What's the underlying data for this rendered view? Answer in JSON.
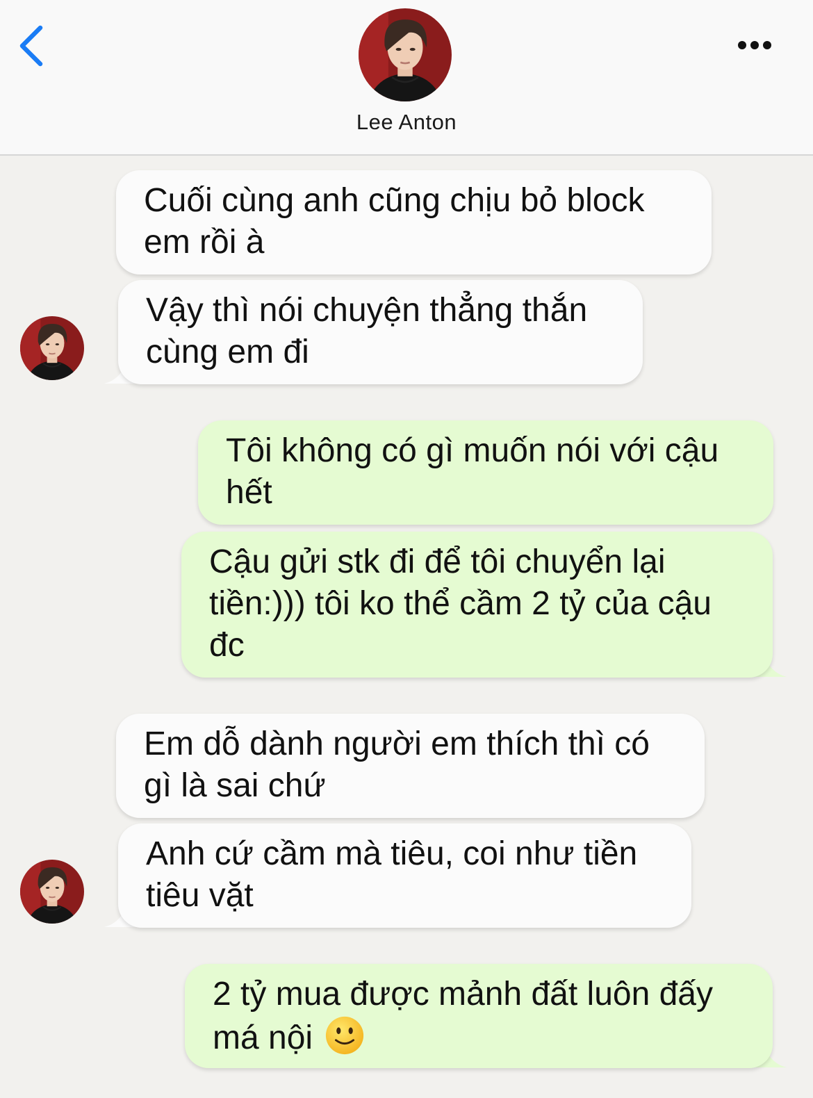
{
  "header": {
    "contact_name": "Lee Anton",
    "back_icon": "chevron-left-icon",
    "more_icon": "ellipsis-icon",
    "accent_color": "#1a7cf5"
  },
  "colors": {
    "incoming_bubble": "#fbfbfb",
    "outgoing_bubble": "#e5fbd2",
    "background": "#f2f1ee"
  },
  "messages": [
    {
      "sender": "contact",
      "text": "Cuối cùng anh cũng chịu bỏ block em rồi à"
    },
    {
      "sender": "contact",
      "text": "Vậy thì nói chuyện thẳng thắn cùng em đi"
    },
    {
      "sender": "me",
      "text": "Tôi không có gì muốn nói với cậu hết"
    },
    {
      "sender": "me",
      "text": "Cậu gửi stk đi để tôi chuyển lại tiền:))) tôi ko thể cầm 2 tỷ của cậu đc"
    },
    {
      "sender": "contact",
      "text": "Em dỗ dành người em thích thì có gì là sai chứ"
    },
    {
      "sender": "contact",
      "text": "Anh cứ cầm mà tiêu, coi như tiền tiêu vặt"
    },
    {
      "sender": "me",
      "text": "2 tỷ mua được mảnh đất luôn đấy má nội",
      "emoji": "slightly-smiling-face-emoji"
    }
  ]
}
